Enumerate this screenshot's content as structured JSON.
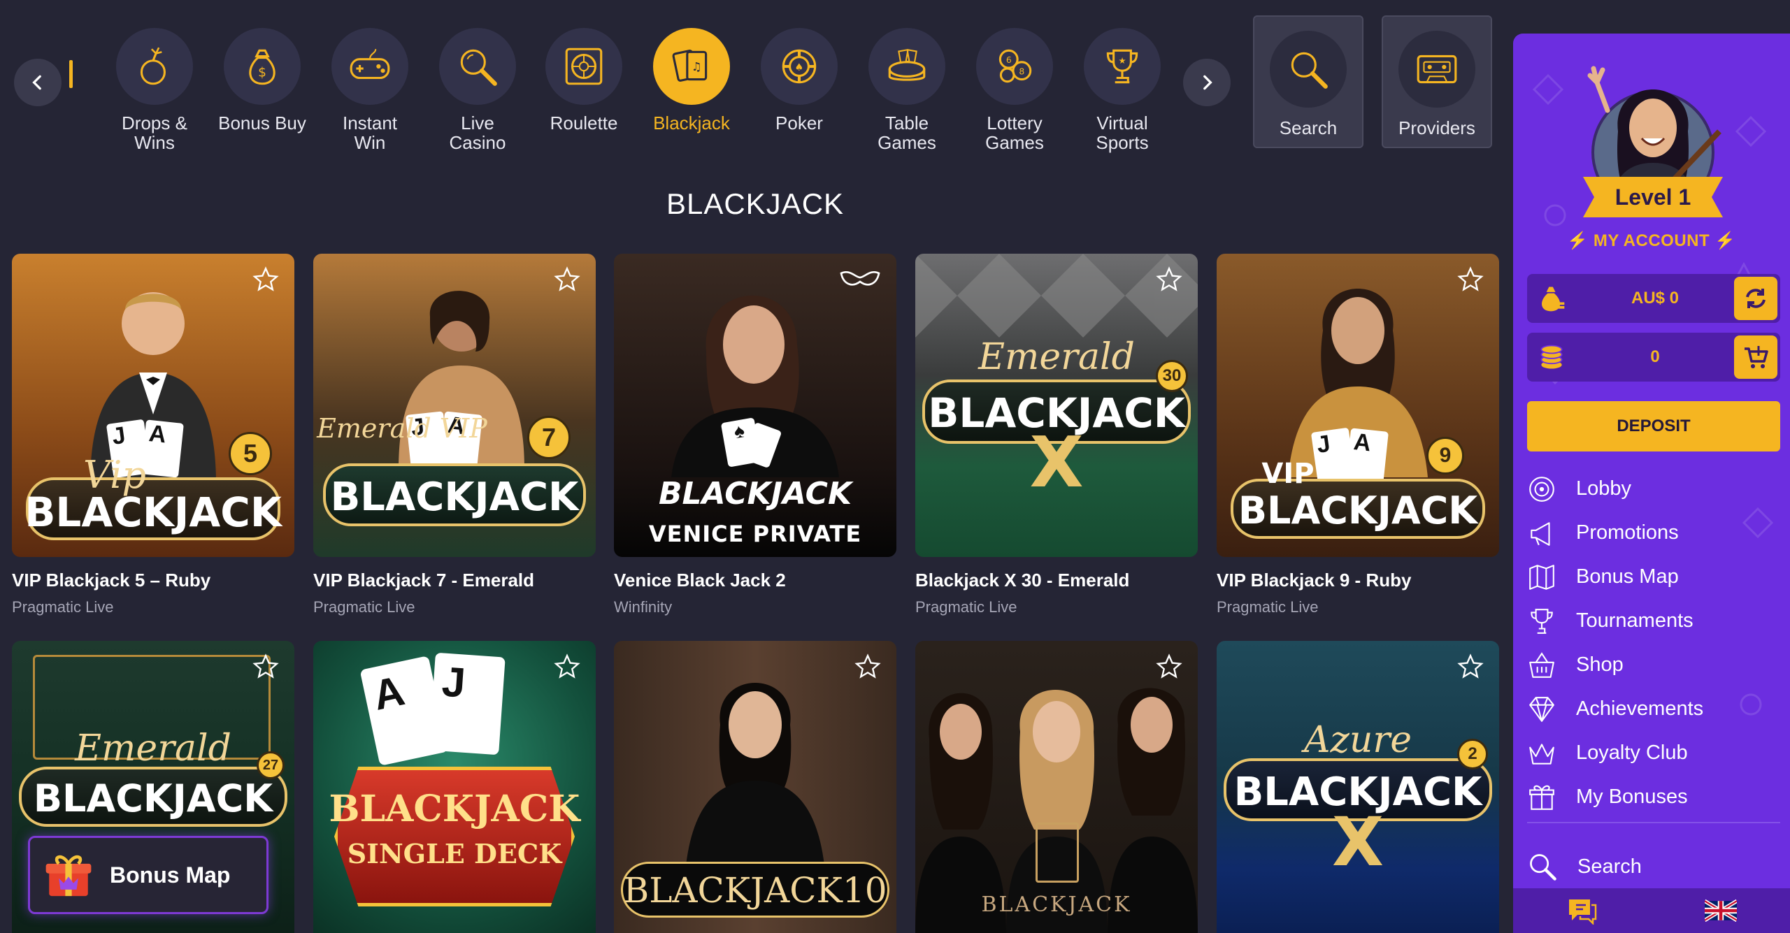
{
  "nav": {
    "categories": [
      {
        "label_l1": "Drops &",
        "label_l2": "Wins",
        "icon": "bomb-icon"
      },
      {
        "label_l1": "Bonus Buy",
        "label_l2": "",
        "icon": "money-bag-icon"
      },
      {
        "label_l1": "Instant",
        "label_l2": "Win",
        "icon": "gamepad-icon"
      },
      {
        "label_l1": "Live",
        "label_l2": "Casino",
        "icon": "magnifier-icon"
      },
      {
        "label_l1": "Roulette",
        "label_l2": "",
        "icon": "roulette-icon"
      },
      {
        "label_l1": "Blackjack",
        "label_l2": "",
        "icon": "cards-icon",
        "active": true
      },
      {
        "label_l1": "Poker",
        "label_l2": "",
        "icon": "poker-chip-icon"
      },
      {
        "label_l1": "Table",
        "label_l2": "Games",
        "icon": "table-icon"
      },
      {
        "label_l1": "Lottery",
        "label_l2": "Games",
        "icon": "lottery-balls-icon"
      },
      {
        "label_l1": "Virtual",
        "label_l2": "Sports",
        "icon": "trophy-icon"
      }
    ],
    "search_label": "Search",
    "providers_label": "Providers"
  },
  "section_title": "BLACKJACK",
  "games": [
    {
      "title": "VIP Blackjack 5 – Ruby",
      "provider": "Pragmatic Live",
      "art_top": "Vip",
      "art_main": "BLACKJACK",
      "badge": "5"
    },
    {
      "title": "VIP Blackjack 7 - Emerald",
      "provider": "Pragmatic Live",
      "art_top": "Emerald VIP",
      "art_main": "BLACKJACK",
      "badge": "7"
    },
    {
      "title": "Venice Black Jack 2",
      "provider": "Winfinity",
      "art_top": "",
      "art_main": "BLACKJACK",
      "art_sub": "VENICE PRIVATE"
    },
    {
      "title": "Blackjack X 30 - Emerald",
      "provider": "Pragmatic Live",
      "art_top": "Emerald",
      "art_main": "BLACKJACK",
      "badge": "30",
      "art_x": "X"
    },
    {
      "title": "VIP Blackjack 9 - Ruby",
      "provider": "Pragmatic Live",
      "art_top": "VIP",
      "art_main": "BLACKJACK",
      "badge": "9"
    },
    {
      "art_top": "Emerald",
      "art_main": "BLACKJACK",
      "badge": "27"
    },
    {
      "art_main": "BLACKJACK",
      "art_sub": "SINGLE DECK"
    },
    {
      "art_main": "BLACKJACK10"
    },
    {
      "art_main": "BLACKJACK"
    },
    {
      "art_top": "Azure",
      "art_main": "BLACKJACK",
      "badge": "2",
      "art_x": "X"
    }
  ],
  "bonus_float": {
    "label": "Bonus Map"
  },
  "sidebar": {
    "level": "Level 1",
    "my_account": "MY ACCOUNT",
    "balance": "AU$ 0",
    "coins": "0",
    "deposit": "DEPOSIT",
    "menu": [
      {
        "label": "Lobby",
        "icon": "lobby-icon"
      },
      {
        "label": "Promotions",
        "icon": "megaphone-icon"
      },
      {
        "label": "Bonus Map",
        "icon": "map-icon"
      },
      {
        "label": "Tournaments",
        "icon": "trophy-icon"
      },
      {
        "label": "Shop",
        "icon": "basket-icon"
      },
      {
        "label": "Achievements",
        "icon": "diamond-icon"
      },
      {
        "label": "Loyalty Club",
        "icon": "crown-icon"
      },
      {
        "label": "My Bonuses",
        "icon": "gift-icon"
      }
    ],
    "search": "Search"
  },
  "colors": {
    "accent": "#f5b521",
    "sidebar": "#6c2ee0",
    "background": "#252535"
  }
}
